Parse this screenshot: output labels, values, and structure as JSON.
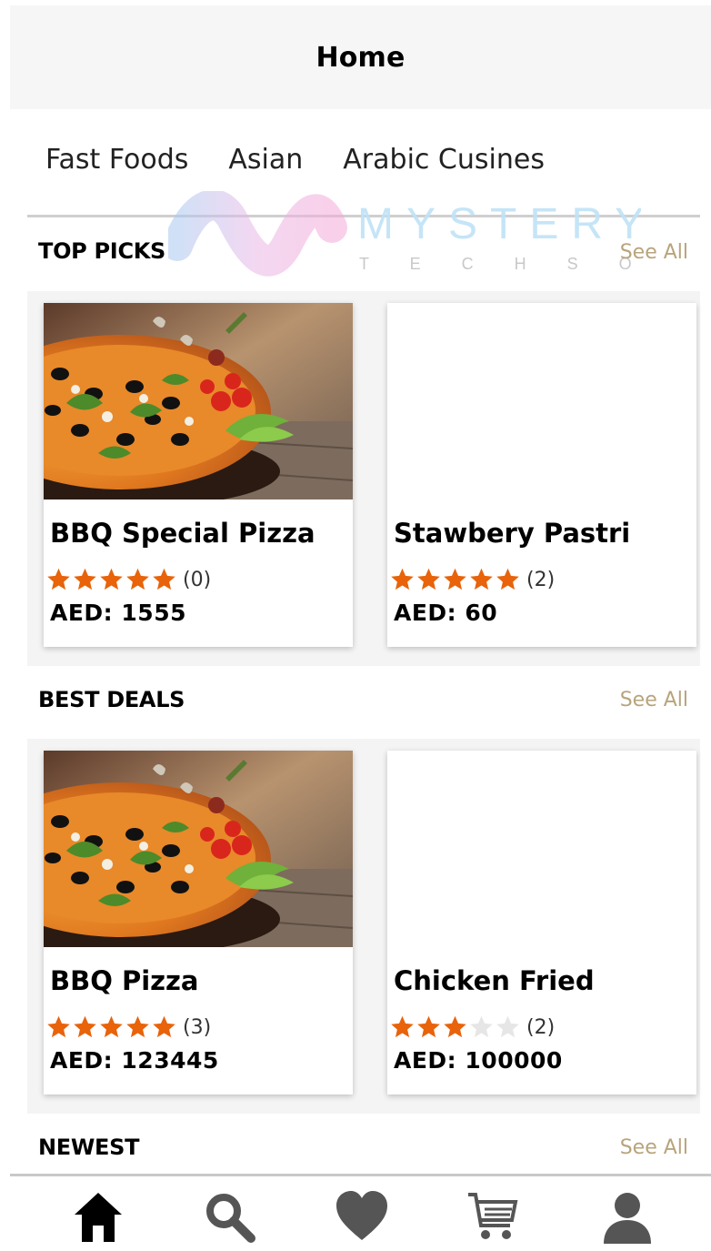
{
  "header": {
    "title": "Home"
  },
  "categories": [
    "Fast Foods",
    "Asian",
    "Arabic Cusines"
  ],
  "watermark": {
    "brand": "MYSTERY",
    "sub": "T E C H S O L"
  },
  "colors": {
    "star": "#e8630a",
    "star_empty": "#e6e6e6",
    "see_all": "#b8a47c",
    "nav_active": "#000000",
    "nav_inactive": "#555555"
  },
  "sections": {
    "top_picks": {
      "title": "TOP PICKS",
      "see_all": "See All",
      "items": [
        {
          "name": "BBQ Special Pizza",
          "rating": 5,
          "reviews": "(0)",
          "price_label": "AED:",
          "price": "1555",
          "image": "pizza"
        },
        {
          "name": "Stawbery Pastri",
          "rating": 5,
          "reviews": "(2)",
          "price_label": "AED:",
          "price": "60",
          "image": "blank"
        }
      ]
    },
    "best_deals": {
      "title": "BEST DEALS",
      "see_all": "See All",
      "items": [
        {
          "name": "BBQ Pizza",
          "rating": 5,
          "reviews": "(3)",
          "price_label": "AED:",
          "price": "123445",
          "image": "pizza"
        },
        {
          "name": "Chicken Fried",
          "rating": 3,
          "reviews": "(2)",
          "price_label": "AED:",
          "price": "100000",
          "image": "blank"
        }
      ]
    },
    "newest": {
      "title": "NEWEST",
      "see_all": "See All"
    }
  },
  "nav": [
    {
      "icon": "home-icon",
      "active": true
    },
    {
      "icon": "search-icon",
      "active": false
    },
    {
      "icon": "heart-icon",
      "active": false
    },
    {
      "icon": "cart-icon",
      "active": false
    },
    {
      "icon": "profile-icon",
      "active": false
    }
  ]
}
